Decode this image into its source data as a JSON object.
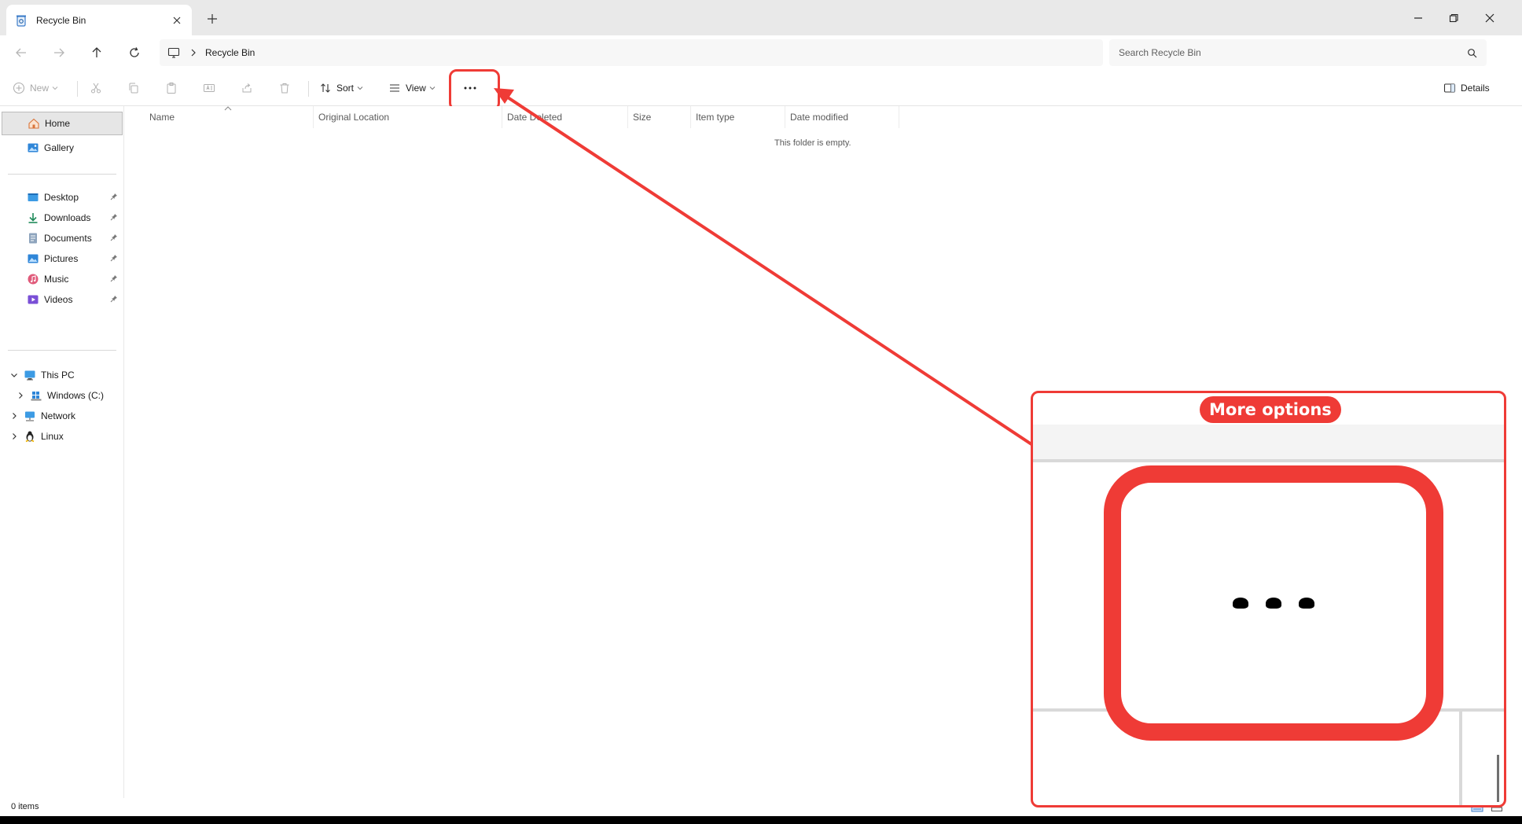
{
  "tab": {
    "title": "Recycle Bin"
  },
  "address": {
    "crumb": "Recycle Bin"
  },
  "search": {
    "placeholder": "Search Recycle Bin"
  },
  "commands": {
    "new_label": "New",
    "sort_label": "Sort",
    "view_label": "View",
    "details_label": "Details"
  },
  "sidebar": {
    "home": "Home",
    "gallery": "Gallery",
    "quick_access": [
      "Desktop",
      "Downloads",
      "Documents",
      "Pictures",
      "Music",
      "Videos"
    ],
    "this_pc": "This PC",
    "windows_c": "Windows (C:)",
    "network": "Network",
    "linux": "Linux"
  },
  "columns": [
    "Name",
    "Original Location",
    "Date Deleted",
    "Size",
    "Item type",
    "Date modified"
  ],
  "content": {
    "empty_message": "This folder is empty."
  },
  "status": {
    "item_count": "0 items"
  },
  "annotation": {
    "label": "More options"
  },
  "colors": {
    "accent_red": "#ef3b36",
    "selection_bg": "#e6e6e6"
  },
  "icons": [
    "recycle-bin-icon",
    "close-icon",
    "plus-icon",
    "minimize-icon",
    "restore-icon",
    "back-arrow-icon",
    "forward-arrow-icon",
    "up-arrow-icon",
    "refresh-icon",
    "monitor-icon",
    "chevron-right-icon",
    "search-icon",
    "new-icon",
    "cut-icon",
    "copy-icon",
    "paste-icon",
    "rename-icon",
    "share-icon",
    "delete-icon",
    "sort-icon",
    "view-icon",
    "more-options-icon",
    "details-pane-icon",
    "home-icon",
    "gallery-icon",
    "desktop-icon",
    "downloads-icon",
    "documents-icon",
    "pictures-icon",
    "music-icon",
    "videos-icon",
    "pin-icon",
    "this-pc-icon",
    "drive-icon",
    "network-icon",
    "linux-icon"
  ]
}
